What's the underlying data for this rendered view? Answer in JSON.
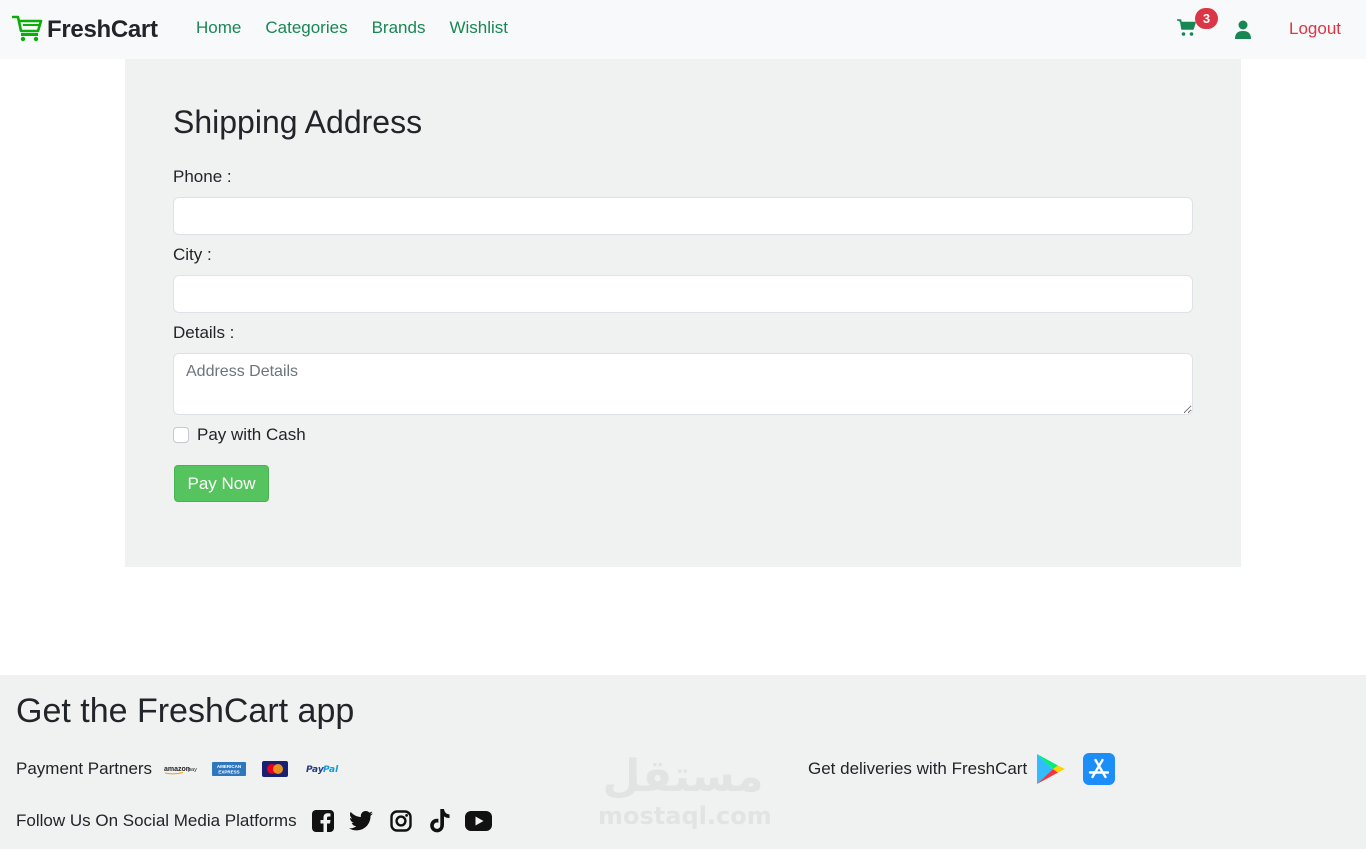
{
  "navbar": {
    "brand": "FreshCart",
    "links": [
      "Home",
      "Categories",
      "Brands",
      "Wishlist"
    ],
    "cart_count": "3",
    "logout_label": "Logout",
    "icons": {
      "brand": "cart-logo-icon",
      "cart": "cart-icon",
      "user": "user-icon"
    }
  },
  "form": {
    "title": "Shipping Address",
    "phone_label": "Phone :",
    "phone_value": "",
    "city_label": "City :",
    "city_value": "",
    "details_label": "Details :",
    "details_placeholder": "Address Details",
    "pay_cash_label": "Pay with Cash",
    "pay_cash_checked": false,
    "pay_button": "Pay Now"
  },
  "footer": {
    "title": "Get the FreshCart app",
    "payment_partners_label": "Payment Partners",
    "payment_partners": [
      "amazon pay",
      "American Express",
      "Mastercard",
      "PayPal"
    ],
    "social_label": "Follow Us On Social Media Platforms",
    "social_icons": [
      "facebook-icon",
      "twitter-icon",
      "instagram-icon",
      "tiktok-icon",
      "youtube-icon"
    ],
    "deliveries_label": "Get deliveries with FreshCart",
    "stores": [
      "google-play-icon",
      "app-store-icon"
    ]
  },
  "watermark": {
    "arabic": "مستقل",
    "latin": "mostaql.com"
  },
  "colors": {
    "brand_green": "#198754",
    "danger": "#dc3545",
    "pay_button": "#55c35e",
    "card_bg": "#f0f2f1",
    "navbar_bg": "#f8f9fa"
  }
}
